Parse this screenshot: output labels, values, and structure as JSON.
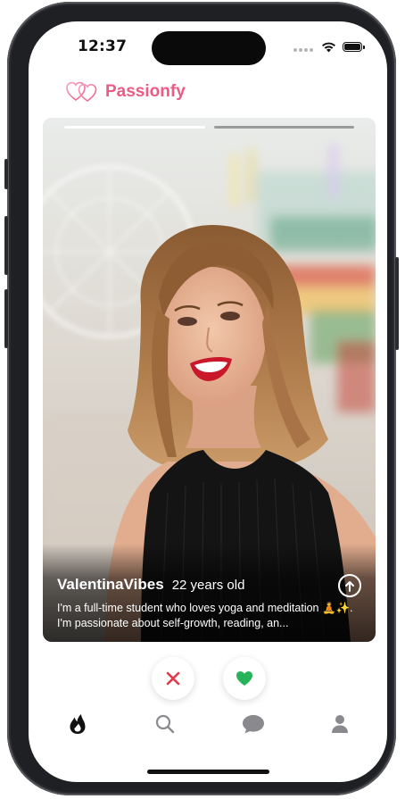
{
  "status_bar": {
    "time": "12:37"
  },
  "header": {
    "brand_name": "Passionfy",
    "brand_color": "#ec5a85"
  },
  "card": {
    "progress": {
      "total": 2,
      "active_index": 0,
      "active_color": "#ffffff",
      "inactive_color": "#9a9a9a"
    },
    "profile": {
      "name": "ValentinaVibes",
      "age_label": "22 years old",
      "bio": "I'm a full-time student who loves yoga and meditation 🧘✨. I'm passionate about self-growth, reading, an..."
    },
    "expand_icon": "arrow-up-circle-icon"
  },
  "actions": {
    "dislike_icon": "x-icon",
    "dislike_color": "#e33b4a",
    "like_icon": "heart-icon",
    "like_color": "#27b35a"
  },
  "tabs": [
    {
      "name": "home",
      "icon": "flame-icon",
      "active": true
    },
    {
      "name": "search",
      "icon": "search-icon",
      "active": false
    },
    {
      "name": "messages",
      "icon": "chat-bubble-icon",
      "active": false
    },
    {
      "name": "profile",
      "icon": "person-icon",
      "active": false
    }
  ]
}
